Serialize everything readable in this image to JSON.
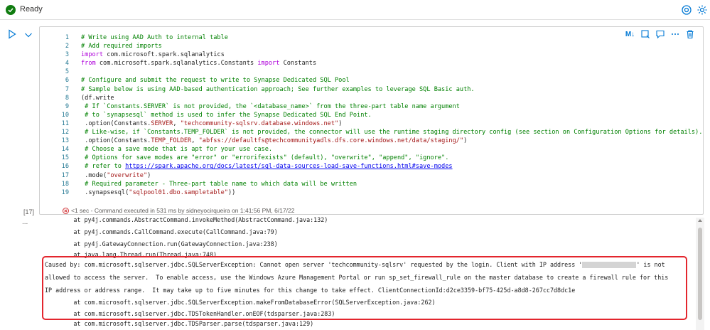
{
  "status": {
    "text": "Ready"
  },
  "toolbar": {
    "markdown_label": "M↓"
  },
  "code": {
    "lines": [
      {
        "n": "1",
        "parts": [
          [
            "c",
            "# Write using AAD Auth to internal table"
          ]
        ]
      },
      {
        "n": "2",
        "parts": [
          [
            "c",
            "# Add required imports"
          ]
        ]
      },
      {
        "n": "3",
        "parts": [
          [
            "k",
            "import"
          ],
          [
            "p",
            " com.microsoft.spark.sqlanalytics"
          ]
        ]
      },
      {
        "n": "4",
        "parts": [
          [
            "k",
            "from"
          ],
          [
            "p",
            " com.microsoft.spark.sqlanalytics.Constants "
          ],
          [
            "k",
            "import"
          ],
          [
            "p",
            " Constants"
          ]
        ]
      },
      {
        "n": "5",
        "parts": []
      },
      {
        "n": "6",
        "parts": [
          [
            "c",
            "# Configure and submit the request to write to Synapse Dedicated SQL Pool"
          ]
        ]
      },
      {
        "n": "7",
        "parts": [
          [
            "c",
            "# Sample below is using AAD-based authentication approach; See further examples to leverage SQL Basic auth."
          ]
        ]
      },
      {
        "n": "8",
        "parts": [
          [
            "p",
            "(df.write"
          ]
        ]
      },
      {
        "n": "9",
        "parts": [
          [
            "c",
            " # If `Constants.SERVER` is not provided, the `<database_name>` from the three-part table name argument"
          ]
        ]
      },
      {
        "n": "10",
        "parts": [
          [
            "c",
            " # to `synapsesql` method is used to infer the Synapse Dedicated SQL End Point."
          ]
        ]
      },
      {
        "n": "11",
        "parts": [
          [
            "p",
            " .option(Constants."
          ],
          [
            "s",
            "SERVER"
          ],
          [
            "p",
            ", "
          ],
          [
            "s",
            "\"techcommunity-sqlsrv.database.windows.net\""
          ],
          [
            "p",
            ")"
          ]
        ]
      },
      {
        "n": "12",
        "parts": [
          [
            "c",
            " # Like-wise, if `Constants.TEMP_FOLDER` is not provided, the connector will use the runtime staging directory config (see section on Configuration Options for details)."
          ]
        ]
      },
      {
        "n": "13",
        "parts": [
          [
            "p",
            " .option(Constants."
          ],
          [
            "s",
            "TEMP_FOLDER"
          ],
          [
            "p",
            ", "
          ],
          [
            "s",
            "\"abfss://defaultfs@techcommunityadls.dfs.core.windows.net/data/staging/\""
          ],
          [
            "p",
            ")"
          ]
        ]
      },
      {
        "n": "14",
        "parts": [
          [
            "c",
            " # Choose a save mode that is apt for your use case."
          ]
        ]
      },
      {
        "n": "15",
        "parts": [
          [
            "c",
            " # Options for save modes are \"error\" or \"errorifexists\" (default), \"overwrite\", \"append\", \"ignore\"."
          ]
        ]
      },
      {
        "n": "16",
        "parts": [
          [
            "c",
            " # refer to "
          ],
          [
            "l",
            "https://spark.apache.org/docs/latest/sql-data-sources-load-save-functions.html#save-modes"
          ]
        ]
      },
      {
        "n": "17",
        "parts": [
          [
            "p",
            " .mode("
          ],
          [
            "s",
            "\"overwrite\""
          ],
          [
            "p",
            ")"
          ]
        ]
      },
      {
        "n": "18",
        "parts": [
          [
            "c",
            " # Required parameter - Three-part table name to which data will be written"
          ]
        ]
      },
      {
        "n": "19",
        "parts": [
          [
            "p",
            " .synapsesql("
          ],
          [
            "s",
            "\"sqlpool01.dbo.sampletable\""
          ],
          [
            "p",
            "))"
          ]
        ]
      }
    ]
  },
  "execution": {
    "count": "[17]",
    "status": "<1 sec - Command executed in 531 ms by sidneyocirqueira on 1:41:56 PM, 6/17/22",
    "more": "..."
  },
  "output": {
    "lines": [
      "        at py4j.commands.AbstractCommand.invokeMethod(AbstractCommand.java:132)",
      "        at py4j.commands.CallCommand.execute(CallCommand.java:79)",
      "        at py4j.GatewayConnection.run(GatewayConnection.java:238)",
      "        at java.lang.Thread.run(Thread.java:748)",
      "Caused by: com.microsoft.sqlserver.jdbc.SQLServerException: Cannot open server 'techcommunity-sqlsrv' requested by the login. Client with IP address '",
      "allowed to access the server.  To enable access, use the Windows Azure Management Portal or run sp_set_firewall_rule on the master database to create a firewall rule for this",
      "IP address or address range.  It may take up to five minutes for this change to take effect. ClientConnectionId:d2ce3359-bf75-425d-a8d8-267cc7d8dc1e",
      "        at com.microsoft.sqlserver.jdbc.SQLServerException.makeFromDatabaseError(SQLServerException.java:262)",
      "        at com.microsoft.sqlserver.jdbc.TDSTokenHandler.onEOF(tdsparser.java:283)",
      "        at com.microsoft.sqlserver.jdbc.TDSParser.parse(tdsparser.java:129)"
    ],
    "caused_by_suffix": "' is not"
  }
}
